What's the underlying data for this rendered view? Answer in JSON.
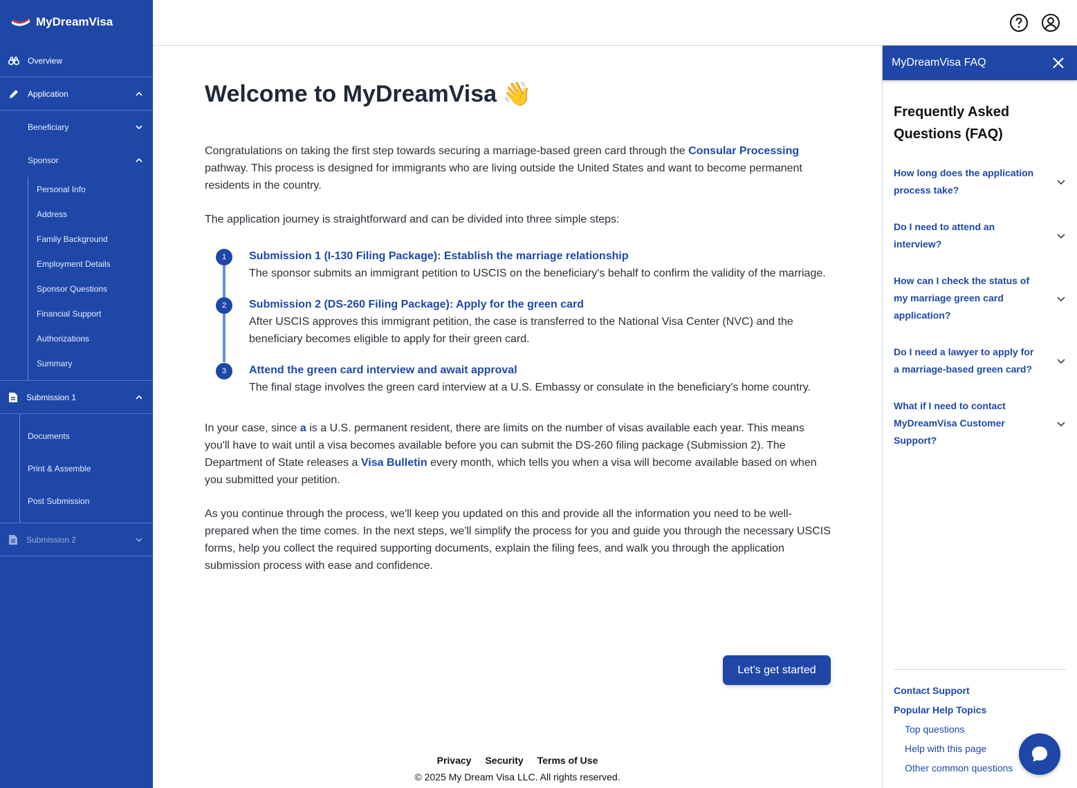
{
  "brand": {
    "name": "MyDreamVisa"
  },
  "sidebar": {
    "overview": "Overview",
    "application": "Application",
    "beneficiary": "Beneficiary",
    "sponsor": "Sponsor",
    "sponsor_items": [
      "Personal Info",
      "Address",
      "Family Background",
      "Employment Details",
      "Sponsor Questions",
      "Financial Support",
      "Authorizations",
      "Summary"
    ],
    "submission1": "Submission 1",
    "submission1_items": [
      "Documents",
      "Print & Assemble",
      "Post Submission"
    ],
    "submission2": "Submission 2"
  },
  "main": {
    "title": "Welcome to MyDreamVisa",
    "wave": "👋",
    "intro_pre": "Congratulations on taking the first step towards securing a marriage-based green card through the ",
    "intro_link": "Consular Processing",
    "intro_post": " pathway. This process is designed for immigrants who are living outside the United States and want to become permanent residents in the country.",
    "journey": "The application journey is straightforward and can be divided into three simple steps:",
    "steps": [
      {
        "num": "1",
        "title": "Submission 1 (I-130 Filing Package): Establish the marriage relationship",
        "desc": "The sponsor submits an immigrant petition to USCIS on the beneficiary's behalf to confirm the validity of the marriage."
      },
      {
        "num": "2",
        "title": "Submission 2 (DS-260 Filing Package): Apply for the green card",
        "desc": "After USCIS approves this immigrant petition, the case is transferred to the National Visa Center (NVC) and the beneficiary becomes eligible to apply for their green card."
      },
      {
        "num": "3",
        "title": "Attend the green card interview and await approval",
        "desc": "The final stage involves the green card interview at a U.S. Embassy or consulate in the beneficiary's home country."
      }
    ],
    "case_pre": "In your case, since ",
    "case_link": "a",
    "case_mid": " is a U.S. permanent resident, there are limits on the number of visas available each year. This means you'll have to wait until a visa becomes available before you can submit the DS-260 filing package (Submission 2). The Department of State releases a ",
    "case_link2": "Visa Bulletin",
    "case_post": " every month, which tells you when a visa will become available based on when you submitted your petition.",
    "continue": "As you continue through the process, we'll keep you updated on this and provide all the information you need to be well-prepared when the time comes. In the next steps, we'll simplify the process for you and guide you through the necessary USCIS forms, help you collect the required supporting documents, explain the filing fees, and walk you through the application submission process with ease and confidence.",
    "cta": "Let's get started"
  },
  "footer": {
    "links": [
      "Privacy",
      "Security",
      "Terms of Use"
    ],
    "copyright": "© 2025 My Dream Visa LLC. All rights reserved."
  },
  "faq": {
    "header": "MyDreamVisa FAQ",
    "title": "Frequently Asked Questions (FAQ)",
    "questions": [
      "How long does the application process take?",
      "Do I need to attend an interview?",
      "How can I check the status of my marriage green card application?",
      "Do I need a lawyer to apply for a marriage-based green card?",
      "What if I need to contact MyDreamVisa Customer Support?"
    ],
    "contact": "Contact Support",
    "popular": "Popular Help Topics",
    "topics": [
      "Top questions",
      "Help with this page",
      "Other common questions"
    ]
  },
  "colors": {
    "primary": "#1f47a8",
    "accent_bar": "#6f8dd1"
  }
}
